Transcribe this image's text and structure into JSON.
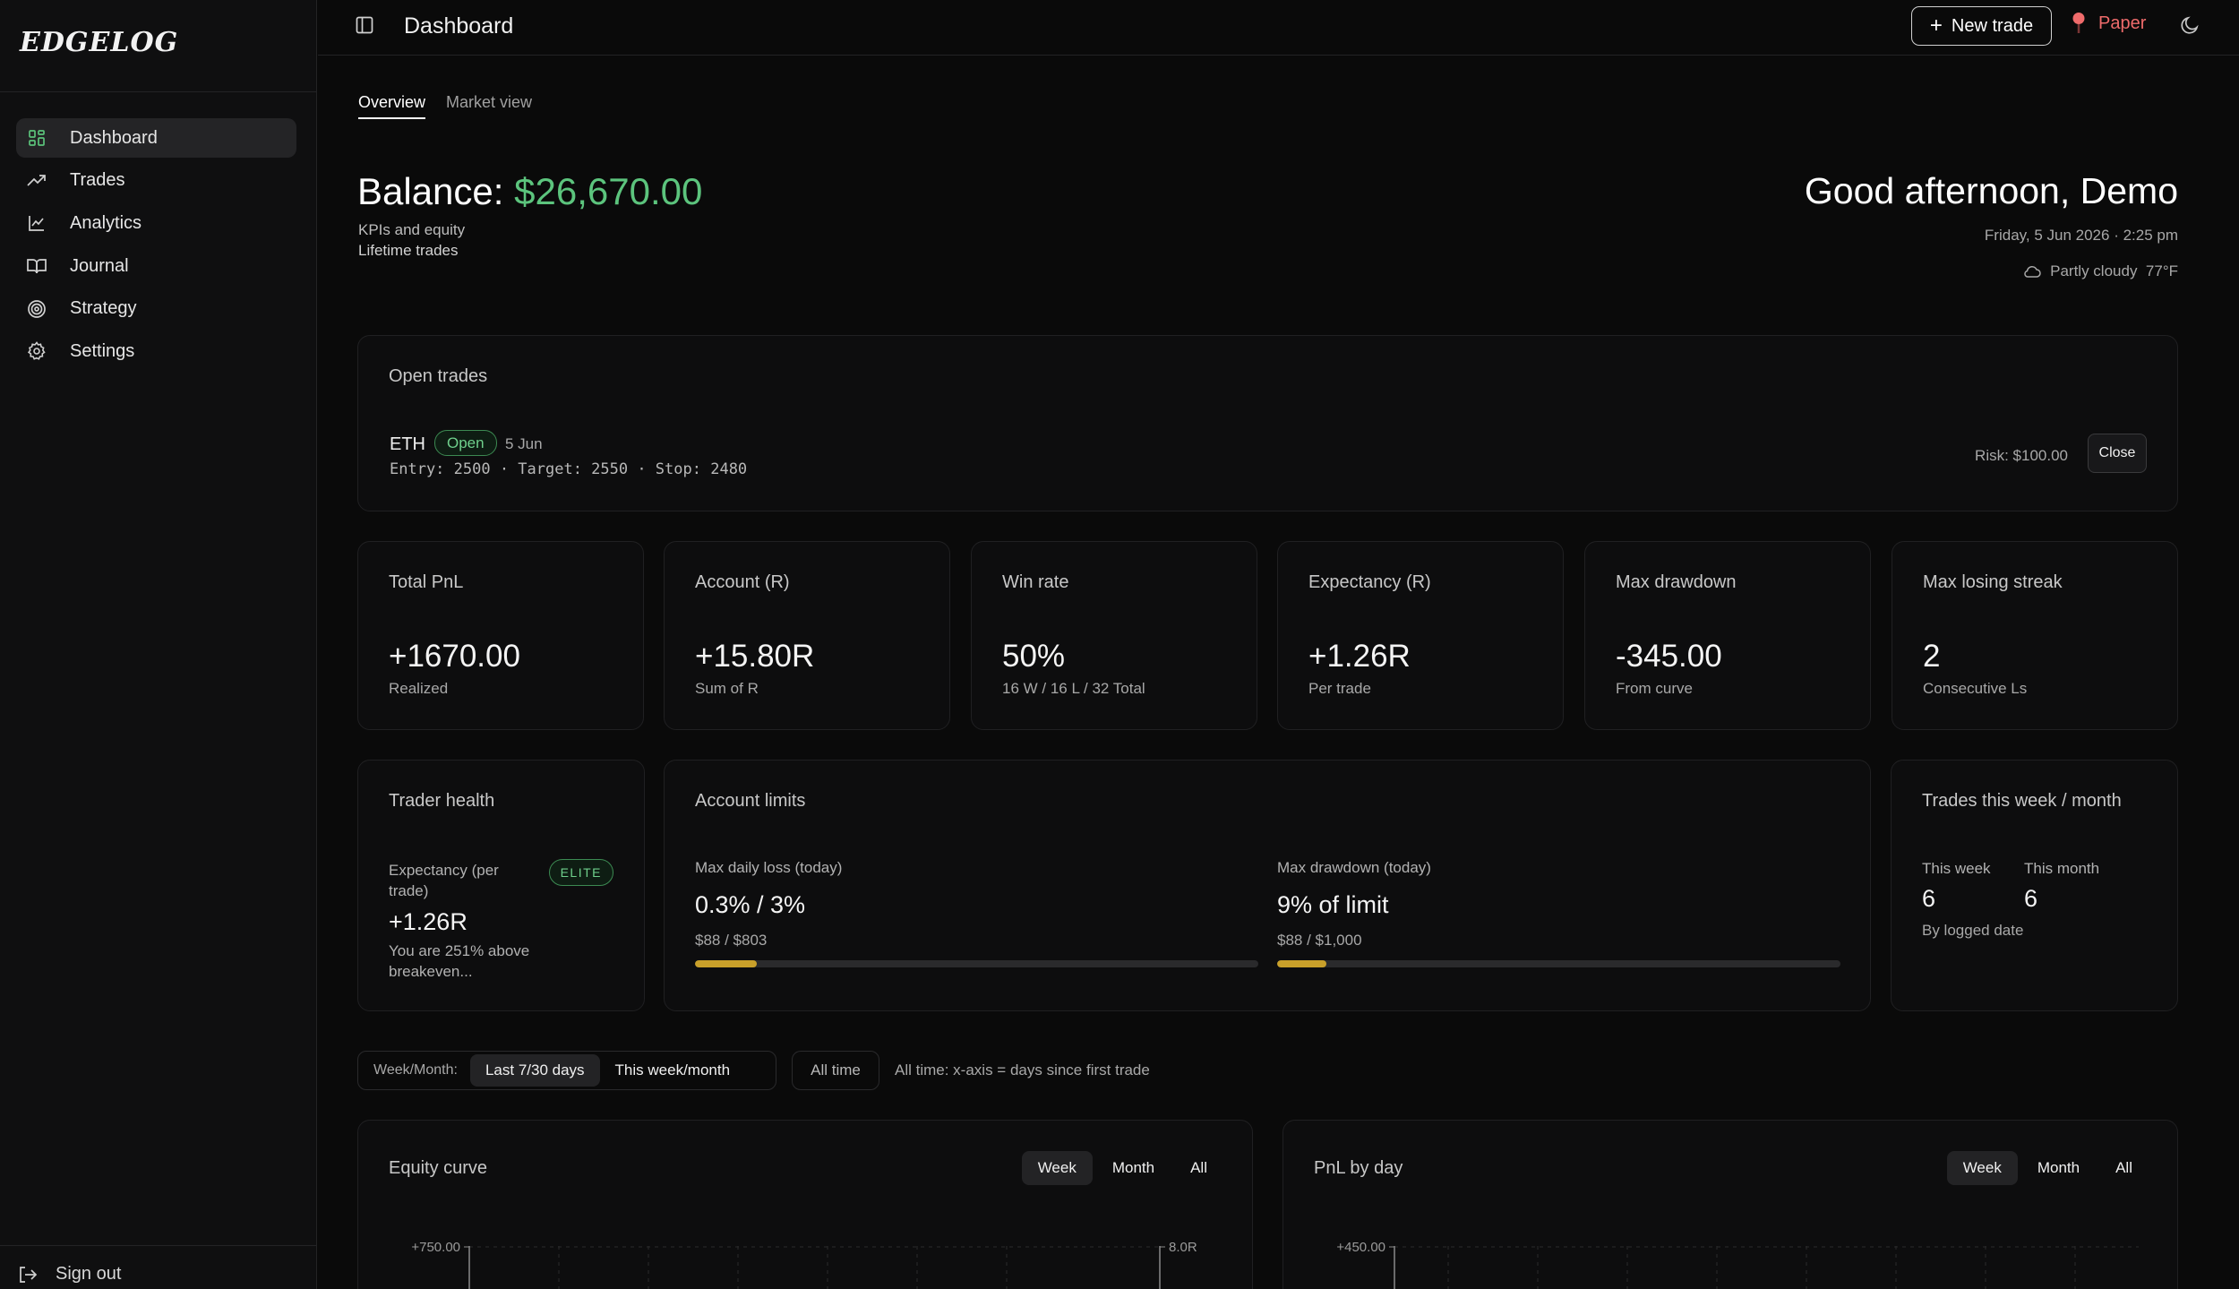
{
  "sidebar": {
    "logo": "EDGELOG",
    "items": [
      {
        "label": "Dashboard",
        "icon": "dashboard-icon",
        "active": true
      },
      {
        "label": "Trades",
        "icon": "trending-up-icon"
      },
      {
        "label": "Analytics",
        "icon": "line-chart-icon"
      },
      {
        "label": "Journal",
        "icon": "book-icon"
      },
      {
        "label": "Strategy",
        "icon": "target-icon"
      },
      {
        "label": "Settings",
        "icon": "gear-icon"
      }
    ],
    "signout": "Sign out"
  },
  "header": {
    "title": "Dashboard",
    "new_trade": "New trade",
    "mode": "Paper",
    "accent": "#ef6b6b"
  },
  "tabs": [
    "Overview",
    "Market view"
  ],
  "balance": {
    "label": "Balance:",
    "value": "$26,670.00",
    "color": "#5cc47d"
  },
  "subtitle": [
    "KPIs and equity",
    "Lifetime trades"
  ],
  "greeting": "Good afternoon, Demo",
  "datetime": "Friday, 5 Jun 2026 · 2:25 pm",
  "weather": {
    "desc": "Partly cloudy",
    "temp": "77°F",
    "icon": "cloud-icon"
  },
  "open_trades": {
    "title": "Open trades",
    "trade": {
      "symbol": "ETH",
      "status": "Open",
      "date": "5 Jun",
      "detail": "Entry: 2500 · Target: 2550 · Stop: 2480",
      "risk": "Risk: $100.00",
      "close": "Close"
    }
  },
  "kpis": [
    {
      "title": "Total PnL",
      "value": "+1670.00",
      "sub": "Realized"
    },
    {
      "title": "Account (R)",
      "value": "+15.80R",
      "sub": "Sum of R"
    },
    {
      "title": "Win rate",
      "value": "50%",
      "sub": "16 W / 16 L / 32 Total"
    },
    {
      "title": "Expectancy (R)",
      "value": "+1.26R",
      "sub": "Per trade"
    },
    {
      "title": "Max drawdown",
      "value": "-345.00",
      "sub": "From curve"
    },
    {
      "title": "Max losing streak",
      "value": "2",
      "sub": "Consecutive Ls"
    }
  ],
  "health": {
    "title": "Trader health",
    "label": "Expectancy (per trade)",
    "badge": "ELITE",
    "value": "+1.26R",
    "note": "You are 251% above breakeven..."
  },
  "limits": {
    "title": "Account limits",
    "daily": {
      "label": "Max daily loss (today)",
      "value": "0.3% / 3%",
      "sub": "$88 / $803",
      "fill": 0.11
    },
    "drawdown": {
      "label": "Max drawdown (today)",
      "value": "9% of limit",
      "sub": "$88 / $1,000",
      "fill": 0.088
    }
  },
  "trades_week": {
    "title": "Trades this week / month",
    "week_label": "This week",
    "week_value": "6",
    "month_label": "This month",
    "month_value": "6",
    "note": "By logged date"
  },
  "filters": {
    "label": "Week/Month:",
    "options": [
      "Last 7/30 days",
      "This week/month"
    ],
    "all_time": "All time",
    "note": "All time: x-axis = days since first trade"
  },
  "charts": [
    {
      "title": "Equity curve",
      "seg": [
        "Week",
        "Month",
        "All"
      ],
      "y_left": "+750.00",
      "y_right": "8.0R"
    },
    {
      "title": "PnL by day",
      "seg": [
        "Week",
        "Month",
        "All"
      ],
      "y_left": "+450.00"
    }
  ]
}
